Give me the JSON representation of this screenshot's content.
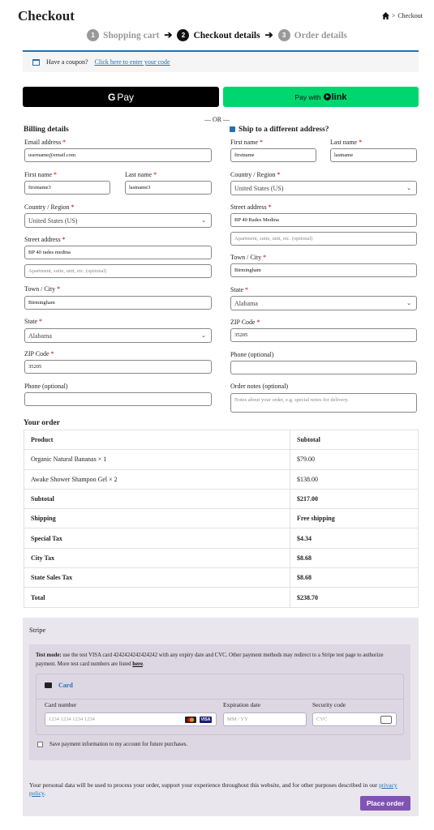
{
  "header": {
    "title": "Checkout",
    "breadcrumb": "Checkout"
  },
  "steps": [
    {
      "num": "1",
      "label": "Shopping cart"
    },
    {
      "num": "2",
      "label": "Checkout details"
    },
    {
      "num": "3",
      "label": "Order details"
    }
  ],
  "coupon": {
    "text": "Have a coupon?",
    "link": "Click here to enter your code"
  },
  "express": {
    "gpay_label": "Pay",
    "link_prefix": "Pay with",
    "link_brand": "link",
    "or": "— OR —"
  },
  "billing": {
    "title": "Billing details",
    "email_label": "Email address",
    "email": "username@email.com",
    "first_name_label": "First name",
    "first_name": "firstname3",
    "last_name_label": "Last name",
    "last_name": "lastname3",
    "country_label": "Country / Region",
    "country": "United States (US)",
    "street_label": "Street address",
    "street": "BP 40 rades medina",
    "street2_placeholder": "Apartment, suite, unit, etc. (optional)",
    "city_label": "Town / City",
    "city": "Birmingham",
    "state_label": "State",
    "state": "Alabama",
    "zip_label": "ZIP Code",
    "zip": "35205",
    "phone_label": "Phone (optional)"
  },
  "shipping": {
    "title": "Ship to a different address?",
    "first_name_label": "First name",
    "first_name": "firstname",
    "last_name_label": "Last name",
    "last_name": "lastname",
    "country_label": "Country / Region",
    "country": "United States (US)",
    "street_label": "Street address",
    "street": "BP 40 Rades Medina",
    "street2_placeholder": "Apartment, suite, unit, etc. (optional)",
    "city_label": "Town / City",
    "city": "Birmingham",
    "state_label": "State",
    "state": "Alabama",
    "zip_label": "ZIP Code",
    "zip": "35205",
    "phone_label": "Phone (optional)",
    "notes_label": "Order notes (optional)",
    "notes_placeholder": "Notes about your order, e.g. special notes for delivery."
  },
  "order": {
    "title": "Your order",
    "headers": [
      "Product",
      "Subtotal"
    ],
    "rows": [
      [
        "Organic Natural Bananas  × 1",
        "$79.00"
      ],
      [
        "Awake Shower Shampoo Gel  × 2",
        "$138.00"
      ]
    ],
    "totals": [
      [
        "Subtotal",
        "$217.00"
      ],
      [
        "Shipping",
        "Free shipping"
      ],
      [
        "Special Tax",
        "$4.34"
      ],
      [
        "City Tax",
        "$8.68"
      ],
      [
        "State Sales Tax",
        "$8.68"
      ],
      [
        "Total",
        "$238.70"
      ]
    ]
  },
  "payment": {
    "method": "Stripe",
    "testmode_label": "Test mode:",
    "testmode_text": "use the test VISA card 4242424242424242 with any expiry date and CVC. Other payment methods may redirect to a Stripe test page to authorize payment. More test card numbers are listed",
    "testmode_link": "here",
    "card_tab": "Card",
    "card_number_label": "Card number",
    "card_number_placeholder": "1234 1234 1234 1234",
    "expiry_label": "Expiration date",
    "expiry_placeholder": "MM / YY",
    "cvc_label": "Security code",
    "cvc_placeholder": "CVC",
    "save_label": "Save payment information to my account for future purchases.",
    "privacy_text": "Your personal data will be used to process your order, support your experience throughout this website, and for other purposes described in our",
    "privacy_link": "privacy policy",
    "place_order": "Place order"
  }
}
